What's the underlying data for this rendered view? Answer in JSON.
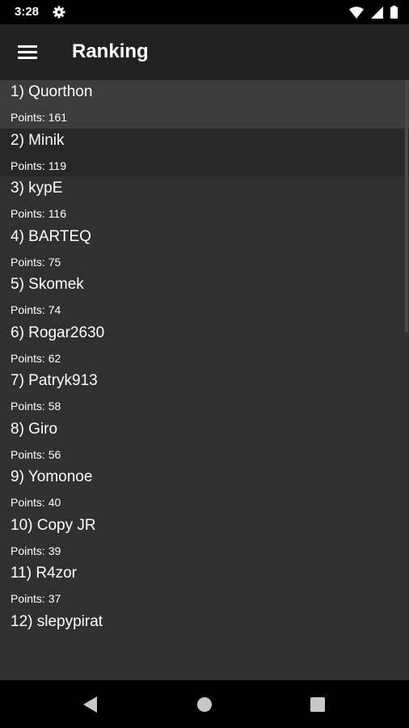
{
  "status": {
    "time": "3:28"
  },
  "header": {
    "title": "Ranking"
  },
  "ranking": [
    {
      "name": "1) Quorthon",
      "points": "Points: 161"
    },
    {
      "name": "2) Minik",
      "points": "Points: 119"
    },
    {
      "name": "3) kypE",
      "points": "Points: 116"
    },
    {
      "name": "4) BARTEQ",
      "points": "Points: 75"
    },
    {
      "name": "5) Skomek",
      "points": "Points: 74"
    },
    {
      "name": "6) Rogar2630",
      "points": "Points: 62"
    },
    {
      "name": "7) Patryk913",
      "points": "Points: 58"
    },
    {
      "name": "8) Giro",
      "points": "Points: 56"
    },
    {
      "name": "9) Yomonoe",
      "points": "Points: 40"
    },
    {
      "name": "10) Copy JR",
      "points": "Points: 39"
    },
    {
      "name": "11) R4zor",
      "points": "Points: 37"
    },
    {
      "name": "12) slepypirat",
      "points": ""
    }
  ],
  "icons": {
    "status": [
      "gear-icon",
      "wifi-icon",
      "signal-icon",
      "battery-icon"
    ],
    "nav": [
      "back-icon",
      "home-icon",
      "recents-icon"
    ]
  },
  "colors": {
    "background": "#303030",
    "app_bar": "#212121",
    "status_bar": "#000000"
  }
}
